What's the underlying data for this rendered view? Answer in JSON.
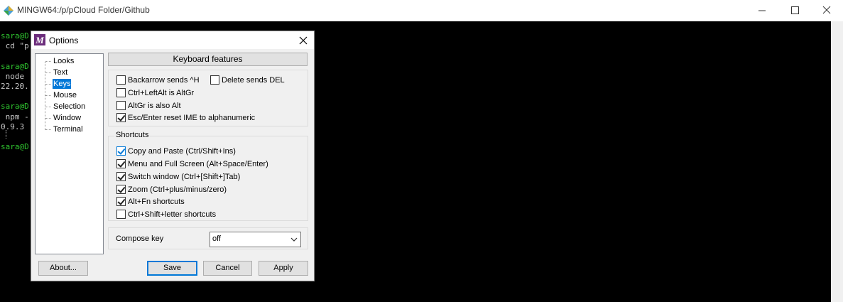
{
  "window": {
    "title": "MINGW64:/p/pCloud Folder/Github"
  },
  "terminal": {
    "lines": [
      {
        "text": "sara@D",
        "color": "#2fc22f"
      },
      {
        "text": " cd \"p",
        "color": "#c8c8c8"
      },
      {
        "text": "",
        "color": "#c8c8c8"
      },
      {
        "text": "sara@D",
        "color": "#2fc22f"
      },
      {
        "text": " node ",
        "color": "#c8c8c8"
      },
      {
        "text": "22.20.",
        "color": "#c8c8c8"
      },
      {
        "text": "",
        "color": "#c8c8c8"
      },
      {
        "text": "sara@D",
        "color": "#2fc22f"
      },
      {
        "text": " npm -",
        "color": "#c8c8c8"
      },
      {
        "text": "0.9.3",
        "color": "#c8c8c8"
      },
      {
        "text": "",
        "color": "#c8c8c8"
      },
      {
        "text": "sara@D",
        "color": "#2fc22f"
      }
    ]
  },
  "dialog": {
    "title": "Options",
    "tree": [
      {
        "label": "Looks",
        "selected": false
      },
      {
        "label": "Text",
        "selected": false
      },
      {
        "label": "Keys",
        "selected": true
      },
      {
        "label": "Mouse",
        "selected": false
      },
      {
        "label": "Selection",
        "selected": false
      },
      {
        "label": "Window",
        "selected": false
      },
      {
        "label": "Terminal",
        "selected": false
      }
    ],
    "section_header": "Keyboard features",
    "keys": {
      "backarrow": {
        "label": "Backarrow sends ^H",
        "checked": false
      },
      "delete": {
        "label": "Delete sends DEL",
        "checked": false
      },
      "ctrl_alt": {
        "label": "Ctrl+LeftAlt is AltGr",
        "checked": false
      },
      "altgr": {
        "label": "AltGr is also Alt",
        "checked": false
      },
      "esc_enter": {
        "label": "Esc/Enter reset IME to alphanumeric",
        "checked": true
      }
    },
    "shortcuts": {
      "title": "Shortcuts",
      "items": [
        {
          "label": "Copy and Paste (Ctrl/Shift+Ins)",
          "checked": true,
          "focused": true
        },
        {
          "label": "Menu and Full Screen (Alt+Space/Enter)",
          "checked": true,
          "focused": false
        },
        {
          "label": "Switch window (Ctrl+[Shift+]Tab)",
          "checked": true,
          "focused": false
        },
        {
          "label": "Zoom (Ctrl+plus/minus/zero)",
          "checked": true,
          "focused": false
        },
        {
          "label": "Alt+Fn shortcuts",
          "checked": true,
          "focused": false
        },
        {
          "label": "Ctrl+Shift+letter shortcuts",
          "checked": false,
          "focused": false
        }
      ]
    },
    "compose": {
      "label": "Compose key",
      "value": "off"
    },
    "buttons": {
      "about": "About...",
      "save": "Save",
      "cancel": "Cancel",
      "apply": "Apply"
    }
  }
}
